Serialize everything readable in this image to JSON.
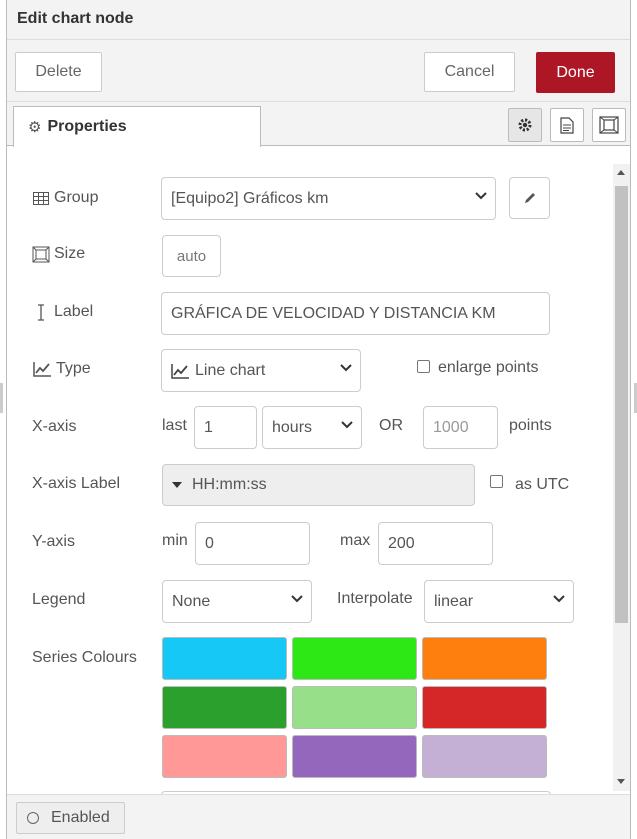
{
  "dialog": {
    "title": "Edit chart node"
  },
  "toolbar": {
    "delete_label": "Delete",
    "cancel_label": "Cancel",
    "done_label": "Done"
  },
  "tabs": {
    "properties_label": "Properties",
    "icons": [
      "gear-icon",
      "description-icon",
      "appearance-icon"
    ]
  },
  "form": {
    "group": {
      "label": "Group",
      "value": "[Equipo2] Gráficos km",
      "icon": "table-icon",
      "edit_icon": "pencil-icon"
    },
    "size": {
      "label": "Size",
      "value": "auto",
      "icon": "resize-icon"
    },
    "label": {
      "label": "Label",
      "value": "GRÁFICA DE VELOCIDAD Y DISTANCIA KM",
      "icon": "text-cursor-icon"
    },
    "type": {
      "label": "Type",
      "value": "Line chart",
      "icon": "line-chart-icon",
      "enlarge_label": "enlarge points",
      "enlarge_checked": false
    },
    "xaxis": {
      "label": "X-axis",
      "last_label": "last",
      "last_value": "1",
      "unit_value": "hours",
      "or_label": "OR",
      "points_placeholder": "1000",
      "points_label": "points"
    },
    "xaxis_label": {
      "label": "X-axis Label",
      "value": "HH:mm:ss",
      "utc_label": "as UTC",
      "utc_checked": false
    },
    "yaxis": {
      "label": "Y-axis",
      "min_label": "min",
      "min_value": "0",
      "max_label": "max",
      "max_value": "200"
    },
    "legend": {
      "label": "Legend",
      "value": "None",
      "interpolate_label": "Interpolate",
      "interpolate_value": "linear"
    },
    "series": {
      "label": "Series Colours",
      "colors": [
        "#15c8f5",
        "#2ee815",
        "#ff7f0e",
        "#2ca02c",
        "#98df8a",
        "#d62728",
        "#ff9896",
        "#9467bd",
        "#c5b0d5"
      ]
    }
  },
  "footer": {
    "enabled_label": "Enabled"
  }
}
